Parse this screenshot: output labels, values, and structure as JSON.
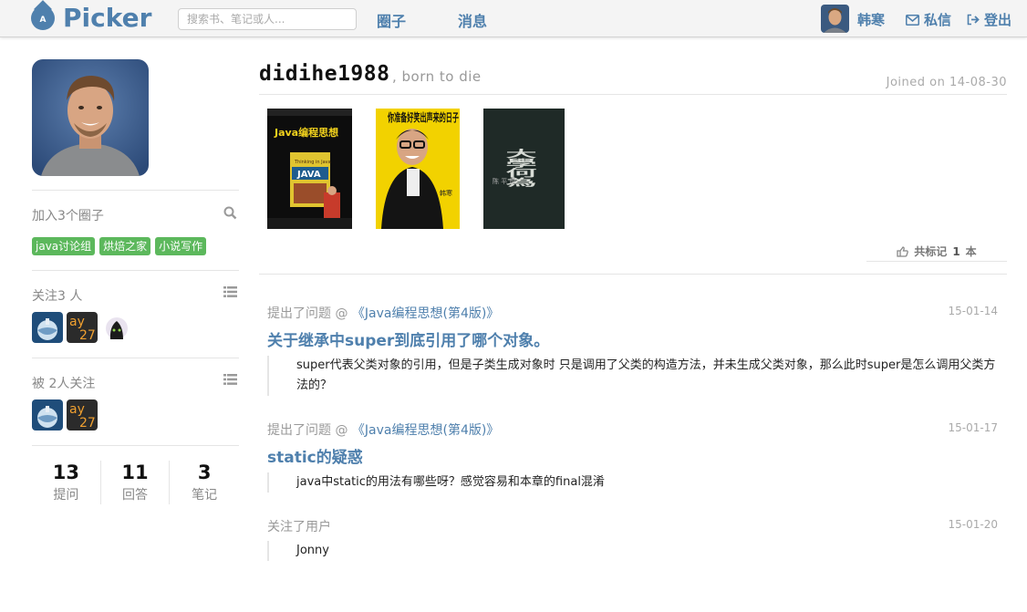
{
  "nav": {
    "logo_letter": "A",
    "logo_text": "Picker",
    "search_placeholder": "搜索书、笔记或人...",
    "circles": "圈子",
    "messages": "消息",
    "user_name": "韩寒",
    "private_msg": "私信",
    "logout": "登出",
    "accent_color": "#4f80ad"
  },
  "sidebar": {
    "joined_circles_title": "加入3个圈子",
    "tags": [
      "java讨论组",
      "烘焙之家",
      "小说写作"
    ],
    "following_title": "关注3 人",
    "followers_title": "被 2人关注",
    "mini_ay_text": "ay",
    "mini_ay_num": "27",
    "stats": [
      {
        "num": "13",
        "label": "提问"
      },
      {
        "num": "11",
        "label": "回答"
      },
      {
        "num": "3",
        "label": "笔记"
      }
    ]
  },
  "profile": {
    "username": "didihe1988",
    "motto": ", born to die",
    "joined": "Joined on 14-08-30"
  },
  "books": {
    "book1_title": "Java编程思想",
    "book1_sub": "Thinking in Java",
    "book1_cover_java": "JAVA",
    "book2_title": "你准备好笑出声来的日子",
    "book3_title": "大學何為"
  },
  "marks": {
    "prefix": "共标记",
    "count": "1",
    "suffix": "本"
  },
  "feed": [
    {
      "action": "提出了问题 @",
      "book": "《Java编程思想(第4版)》",
      "date": "15-01-14",
      "title": "关于继承中super到底引用了哪个对象。",
      "body": "super代表父类对象的引用，但是子类生成对象时 只是调用了父类的构造方法，并未生成父类对象，那么此时super是怎么调用父类方法的？"
    },
    {
      "action": "提出了问题 @",
      "book": "《Java编程思想(第4版)》",
      "date": "15-01-17",
      "title": "static的疑惑",
      "body": "java中static的用法有哪些呀？感觉容易和本章的final混淆"
    },
    {
      "action": "关注了用户",
      "date": "15-01-20",
      "body": "Jonny"
    }
  ]
}
